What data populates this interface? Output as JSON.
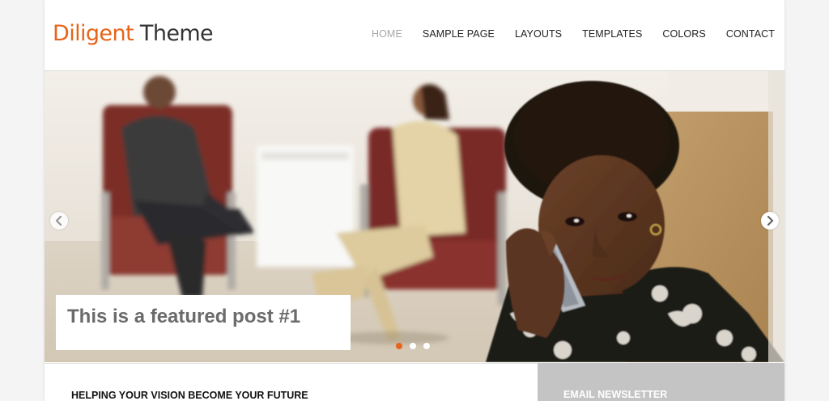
{
  "site": {
    "logo_part1": "Diligent",
    "logo_part2": " Theme"
  },
  "nav": {
    "items": [
      {
        "label": "HOME",
        "active": true
      },
      {
        "label": "SAMPLE PAGE"
      },
      {
        "label": "LAYOUTS"
      },
      {
        "label": "TEMPLATES"
      },
      {
        "label": "COLORS"
      },
      {
        "label": "CONTACT"
      }
    ]
  },
  "slider": {
    "caption": "This is a featured post #1",
    "slide_count": 3,
    "active_slide": 1,
    "prev_icon": "chevron-left-icon",
    "next_icon": "chevron-right-icon"
  },
  "content": {
    "heading": "HELPING YOUR VISION BECOME YOUR FUTURE"
  },
  "sidebar": {
    "heading": "EMAIL NEWSLETTER"
  },
  "colors": {
    "accent": "#e8641b",
    "nav_active": "#a7a7a7",
    "sidebar_bg": "#c4c4c4"
  }
}
